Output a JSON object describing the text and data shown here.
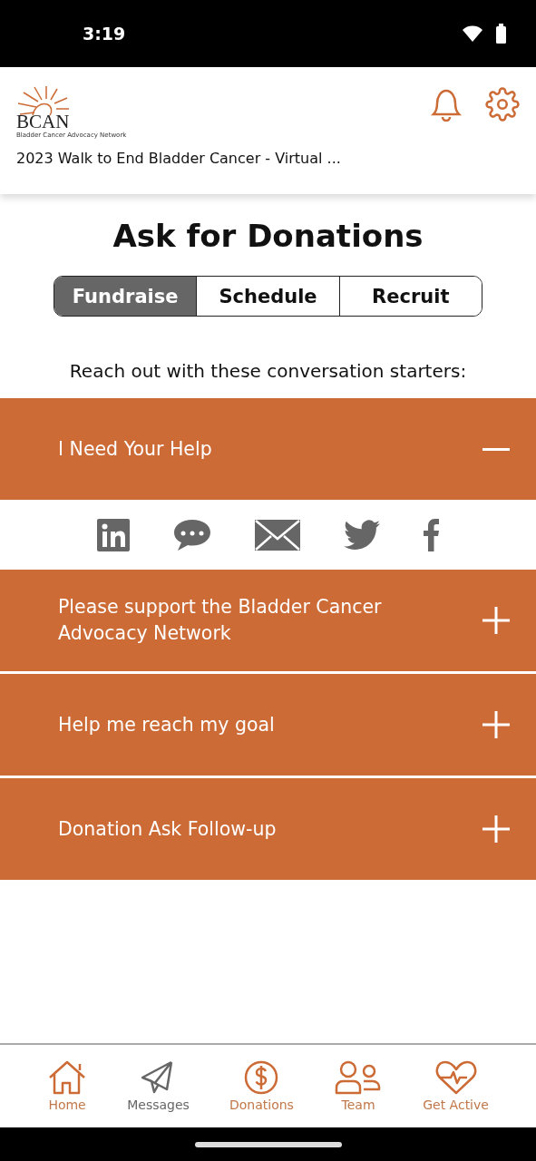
{
  "status_bar": {
    "time": "3:19"
  },
  "header": {
    "logo": {
      "wordmark": "BCAN",
      "tagline": "Bladder Cancer Advocacy Network"
    },
    "event_title": "2023 Walk to End Bladder Cancer - Virtual ..."
  },
  "page_title": "Ask for Donations",
  "tabs": [
    {
      "label": "Fundraise",
      "selected": true
    },
    {
      "label": "Schedule",
      "selected": false
    },
    {
      "label": "Recruit",
      "selected": false
    }
  ],
  "prompt": "Reach out with these conversation starters:",
  "starters": [
    {
      "title": "I Need Your Help",
      "expanded": true,
      "share": [
        {
          "kind": "linkedin"
        },
        {
          "kind": "message"
        },
        {
          "kind": "email"
        },
        {
          "kind": "twitter"
        },
        {
          "kind": "facebook"
        }
      ]
    },
    {
      "title": "Please support the Bladder Cancer Advocacy Network",
      "expanded": false
    },
    {
      "title": "Help me reach my goal",
      "expanded": false
    },
    {
      "title": "Donation Ask Follow-up",
      "expanded": false
    }
  ],
  "nav": [
    {
      "label": "Home",
      "kind": "home",
      "selected": false
    },
    {
      "label": "Messages",
      "kind": "messages",
      "selected": true
    },
    {
      "label": "Donations",
      "kind": "donations",
      "selected": false
    },
    {
      "label": "Team",
      "kind": "team",
      "selected": false
    },
    {
      "label": "Get Active",
      "kind": "active",
      "selected": false
    }
  ]
}
